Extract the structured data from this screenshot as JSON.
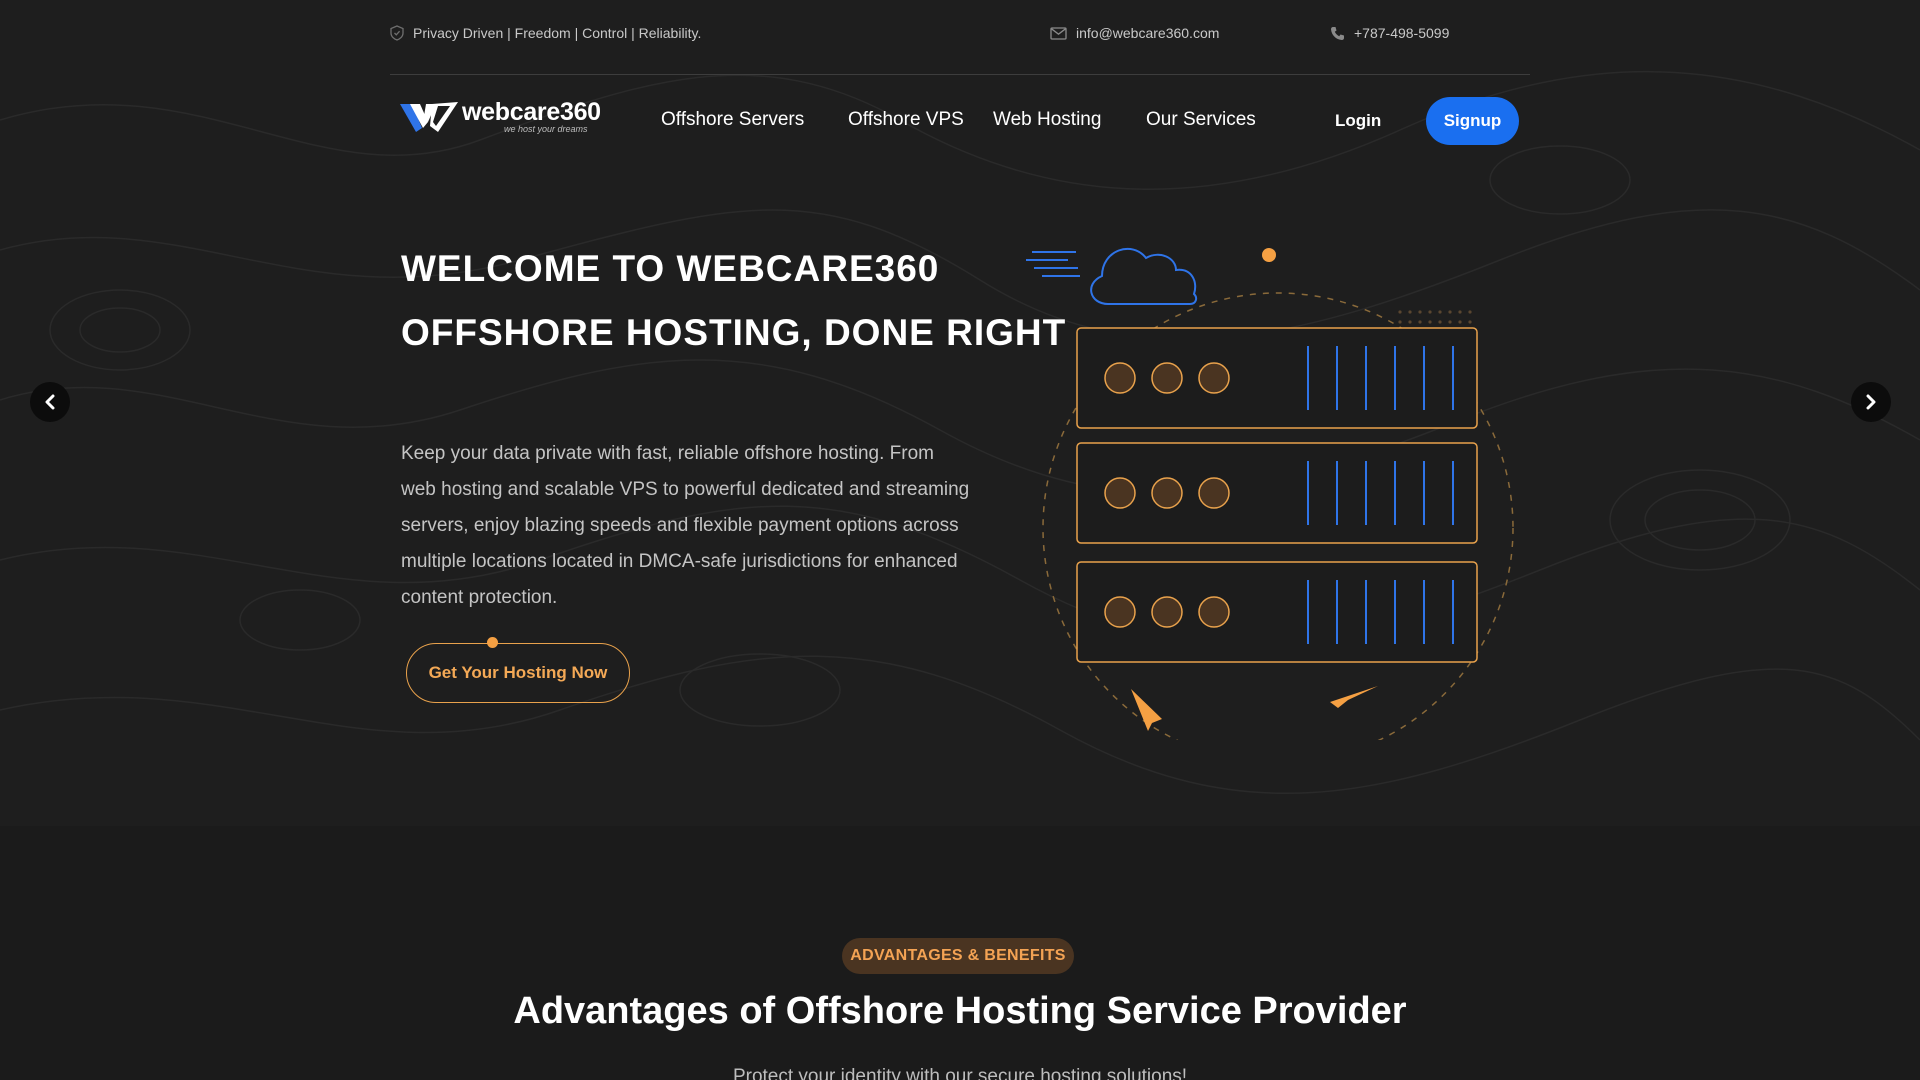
{
  "topbar": {
    "tagline": "Privacy Driven | Freedom | Control | Reliability.",
    "email": "info@webcare360.com",
    "phone": "+787-498-5099"
  },
  "brand": {
    "name": "webcare360",
    "slogan": "we host your dreams",
    "logo_icon": "w-logo-mark"
  },
  "nav": {
    "items": [
      {
        "label": "Offshore Servers"
      },
      {
        "label": "Offshore VPS"
      },
      {
        "label": "Web Hosting"
      },
      {
        "label": "Our Services"
      }
    ],
    "login_label": "Login",
    "signup_label": "Signup"
  },
  "hero": {
    "title_line1": "WELCOME TO WEBCARE360",
    "title_line2": "OFFSHORE HOSTING, DONE RIGHT",
    "description": "Keep your data private with fast, reliable offshore hosting. From web hosting and scalable VPS to powerful dedicated and streaming servers, enjoy blazing speeds and flexible payment options across multiple locations located in DMCA-safe jurisdictions for enhanced content protection.",
    "cta_label": "Get Your Hosting Now",
    "prev_icon": "chevron-left-icon",
    "next_icon": "chevron-right-icon",
    "illustration": "server-rack-cloud-illustration"
  },
  "advantages": {
    "badge": "ADVANTAGES & BENEFITS",
    "title": "Advantages of Offshore Hosting Service Provider",
    "subtitle": "Protect your identity with our secure hosting solutions!"
  },
  "colors": {
    "accent_orange": "#f5a043",
    "brand_blue": "#1a6ff0",
    "hero_bg": "#1e1e1e",
    "section_bg": "#1b1b1b"
  }
}
